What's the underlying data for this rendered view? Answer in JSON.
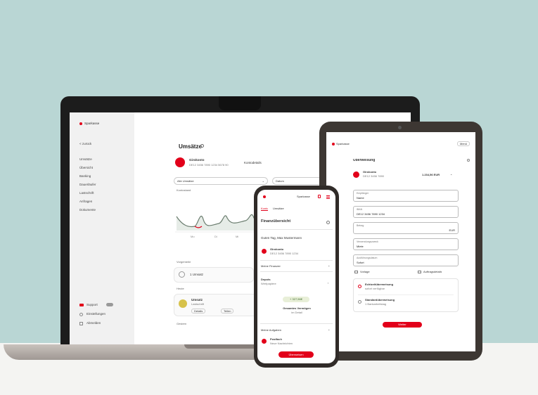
{
  "colors": {
    "wall": "#b9d6d4",
    "brand": "#e2001a",
    "tabletop": "#f4f4f2"
  },
  "laptop": {
    "brand": "Sparkasse",
    "back": "< zurück",
    "nav": [
      "Umsätze",
      "Übersicht",
      "Banking",
      "Dauerläufer",
      "Lastschrift",
      "Anfragen",
      "Dokumente"
    ],
    "footer": [
      "Support",
      "Einstellungen",
      "Abmelden"
    ],
    "title": "Umsätze",
    "account_name": "Girokonto",
    "account_sub": "DE12 3456 7890 1234 5678 90",
    "account_action": "Kontodetails",
    "filter": "Alle Umsätze",
    "sort": "Datum",
    "balance_label": "Kontostand",
    "chart_x": [
      "Mo",
      "Di",
      "Mi",
      "Do"
    ],
    "section1": "Vorgemerkt",
    "item1": "1 Umsatz",
    "section2": "Heute",
    "item2_title": "Umsatz",
    "item2_sub": "Lastschrift",
    "item2_actions": [
      "Details",
      "Teilen"
    ],
    "section3": "Gestern"
  },
  "tablet": {
    "brand": "Sparkasse",
    "menu": "Menü",
    "title": "Überweisung",
    "from_name": "Girokonto",
    "from_sub": "DE12 3456 7890",
    "from_amount": "1.234,56 EUR",
    "fields": [
      {
        "label": "Empfänger",
        "value": "Name"
      },
      {
        "label": "IBAN",
        "value": "DE12 3456 7890 1234"
      },
      {
        "label": "Betrag",
        "value": "EUR"
      },
      {
        "label": "Verwendungszweck",
        "value": "Miete"
      },
      {
        "label": "Ausführungsdatum",
        "value": "Sofort"
      }
    ],
    "links": [
      "Vorlage",
      "Auftragsdetails"
    ],
    "options": [
      {
        "title": "Echtzeitüberweisung",
        "sub": "sofort verfügbar"
      },
      {
        "title": "Standardüberweisung",
        "sub": "1 Bankarbeitstag"
      }
    ],
    "submit": "Weiter"
  },
  "phone": {
    "brand": "Sparkasse",
    "tabs": [
      "Konto",
      "Umsätze"
    ],
    "title": "Finanzübersicht",
    "subtitle": "Guten Tag, Max Mustermann",
    "item1_title": "Girokonto",
    "item1_sub": "DE12 3456 7890 1234",
    "section1": "Meine Finanzen",
    "section2": "Depots",
    "section2_sub": "Wertpapiere",
    "chip": "+ 327,56€",
    "center_title": "Gesamtes Vermögen",
    "center_sub": "im Detail",
    "section3": "Meine Aufgaben",
    "item2_title": "Postfach",
    "item2_sub": "Neue Nachrichten",
    "button": "Überweisen"
  }
}
